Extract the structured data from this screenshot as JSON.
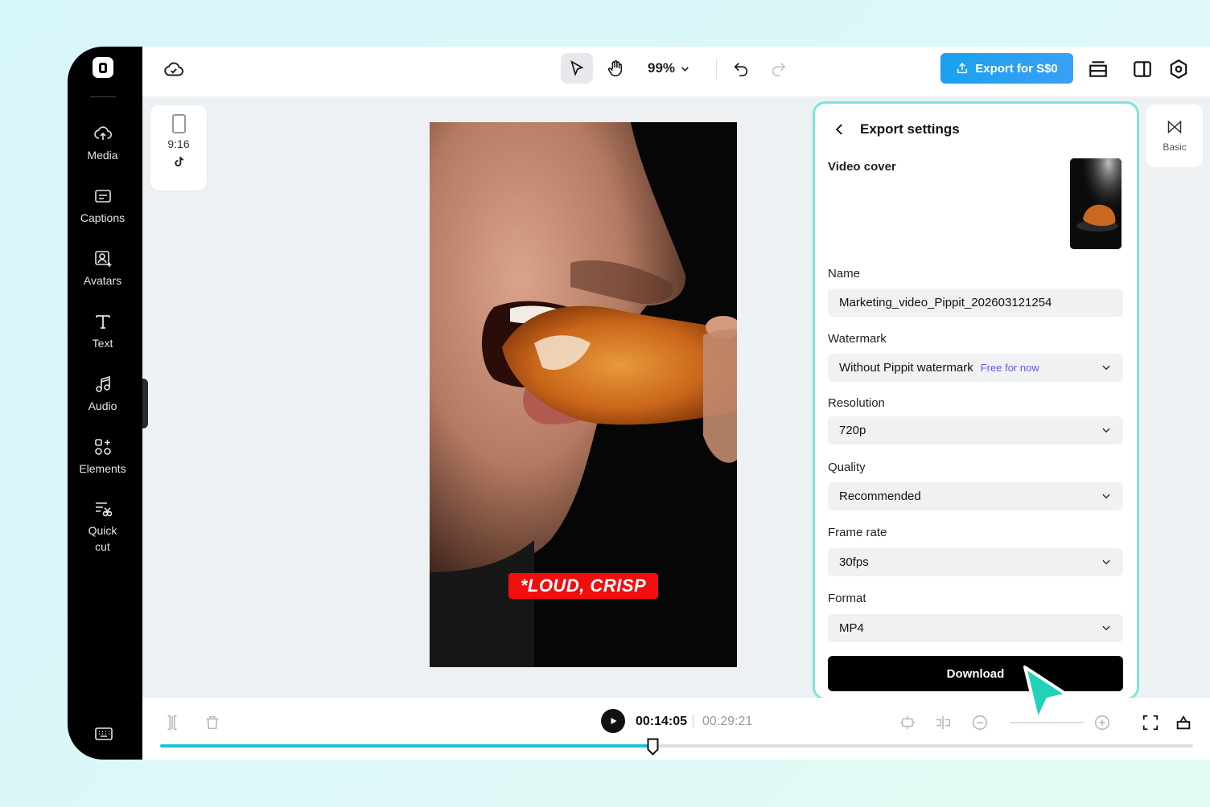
{
  "sidebar": {
    "items": [
      {
        "label": "Media",
        "icon": "cloud-upload-icon"
      },
      {
        "label": "Captions",
        "icon": "captions-icon"
      },
      {
        "label": "Avatars",
        "icon": "avatar-icon"
      },
      {
        "label": "Text",
        "icon": "text-icon"
      },
      {
        "label": "Audio",
        "icon": "music-note-icon"
      },
      {
        "label": "Elements",
        "icon": "elements-icon"
      },
      {
        "label": "Quick\ncut",
        "icon": "quick-cut-icon"
      }
    ]
  },
  "topbar": {
    "zoom": "99%",
    "export_label": "Export for S$0"
  },
  "aspect": {
    "ratio": "9:16"
  },
  "video": {
    "caption": "*LOUD, CRISP"
  },
  "export_panel": {
    "title": "Export settings",
    "video_cover_label": "Video cover",
    "name_label": "Name",
    "name_value": "Marketing_video_Pippit_202603121254",
    "watermark_label": "Watermark",
    "watermark_value": "Without Pippit watermark",
    "watermark_badge": "Free for now",
    "resolution_label": "Resolution",
    "resolution_value": "720p",
    "quality_label": "Quality",
    "quality_value": "Recommended",
    "frame_rate_label": "Frame rate",
    "frame_rate_value": "30fps",
    "format_label": "Format",
    "format_value": "MP4",
    "download_label": "Download"
  },
  "basic_card": {
    "label": "Basic"
  },
  "timeline": {
    "current_time": "00:14:05",
    "total_time": "00:29:21",
    "progress": 0.477
  },
  "colors": {
    "accent": "#17c3dc",
    "export_button": "#1aa0f0",
    "caption_bg": "#f30e0e",
    "panel_border": "#7de4dd"
  }
}
